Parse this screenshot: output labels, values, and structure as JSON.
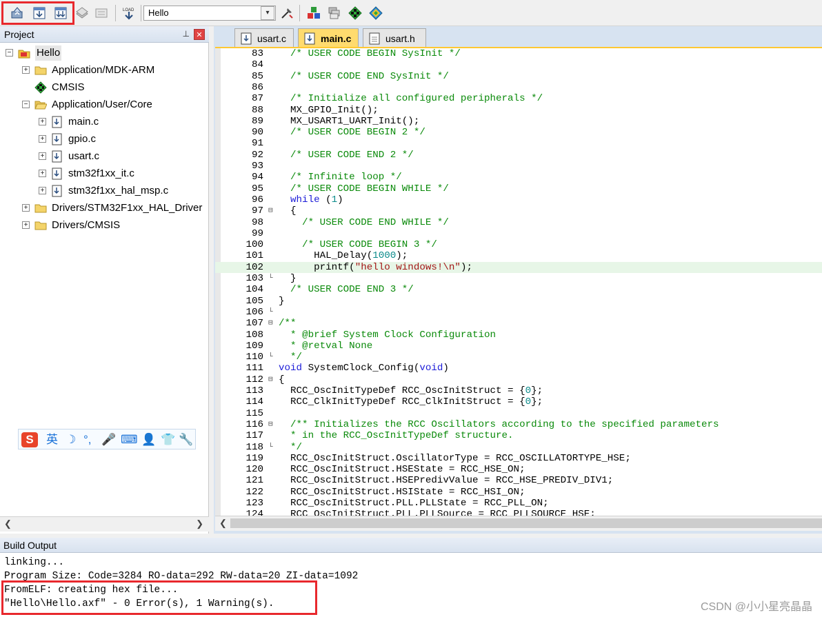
{
  "toolbar": {
    "target_name": "Hello",
    "buttons": [
      "translate-icon",
      "build-icon",
      "rebuild-icon",
      "batch-build-icon",
      "stop-build-icon",
      "download-icon",
      "target-options-icon",
      "manage-components-icon",
      "pack-installer-icon",
      "event-recorder-icon",
      "rte-icon"
    ]
  },
  "project": {
    "title": "Project",
    "tree": [
      {
        "label": "Hello",
        "level": 0,
        "type": "root",
        "expander": "-"
      },
      {
        "label": "Application/MDK-ARM",
        "level": 1,
        "type": "folder",
        "expander": "+"
      },
      {
        "label": "CMSIS",
        "level": 1,
        "type": "component",
        "expander": ""
      },
      {
        "label": "Application/User/Core",
        "level": 1,
        "type": "folder-open",
        "expander": "-"
      },
      {
        "label": "main.c",
        "level": 2,
        "type": "file",
        "expander": "+"
      },
      {
        "label": "gpio.c",
        "level": 2,
        "type": "file",
        "expander": "+"
      },
      {
        "label": "usart.c",
        "level": 2,
        "type": "file",
        "expander": "+"
      },
      {
        "label": "stm32f1xx_it.c",
        "level": 2,
        "type": "file",
        "expander": "+"
      },
      {
        "label": "stm32f1xx_hal_msp.c",
        "level": 2,
        "type": "file",
        "expander": "+"
      },
      {
        "label": "Drivers/STM32F1xx_HAL_Driver",
        "level": 1,
        "type": "folder",
        "expander": "+"
      },
      {
        "label": "Drivers/CMSIS",
        "level": 1,
        "type": "folder",
        "expander": "+"
      }
    ],
    "ime_toolbar": [
      "S",
      "英",
      "☽",
      "°,",
      "🎤",
      "⌨",
      "👤",
      "👕",
      "🔧"
    ]
  },
  "editor": {
    "tabs": [
      {
        "label": "usart.c",
        "active": false
      },
      {
        "label": "main.c",
        "active": true
      },
      {
        "label": "usart.h",
        "active": false
      }
    ],
    "lines": [
      {
        "n": "83",
        "fold": "",
        "text": "  /* USER CODE BEGIN SysInit */",
        "kind": "cm"
      },
      {
        "n": "84",
        "fold": "",
        "text": "",
        "kind": ""
      },
      {
        "n": "85",
        "fold": "",
        "text": "  /* USER CODE END SysInit */",
        "kind": "cm"
      },
      {
        "n": "86",
        "fold": "",
        "text": "",
        "kind": ""
      },
      {
        "n": "87",
        "fold": "",
        "text": "  /* Initialize all configured peripherals */",
        "kind": "cm"
      },
      {
        "n": "88",
        "fold": "",
        "text": "  MX_GPIO_Init();",
        "kind": ""
      },
      {
        "n": "89",
        "fold": "",
        "text": "  MX_USART1_UART_Init();",
        "kind": ""
      },
      {
        "n": "90",
        "fold": "",
        "text": "  /* USER CODE BEGIN 2 */",
        "kind": "cm"
      },
      {
        "n": "91",
        "fold": "",
        "text": "",
        "kind": ""
      },
      {
        "n": "92",
        "fold": "",
        "text": "  /* USER CODE END 2 */",
        "kind": "cm"
      },
      {
        "n": "93",
        "fold": "",
        "text": "",
        "kind": ""
      },
      {
        "n": "94",
        "fold": "",
        "text": "  /* Infinite loop */",
        "kind": "cm"
      },
      {
        "n": "95",
        "fold": "",
        "text": "  /* USER CODE BEGIN WHILE */",
        "kind": "cm"
      },
      {
        "n": "96",
        "fold": "",
        "text": "  while (1)",
        "kind": "while"
      },
      {
        "n": "97",
        "fold": "⊟",
        "text": "  {",
        "kind": ""
      },
      {
        "n": "98",
        "fold": "",
        "text": "    /* USER CODE END WHILE */",
        "kind": "cm"
      },
      {
        "n": "99",
        "fold": "",
        "text": "",
        "kind": ""
      },
      {
        "n": "100",
        "fold": "",
        "text": "    /* USER CODE BEGIN 3 */",
        "kind": "cm"
      },
      {
        "n": "101",
        "fold": "",
        "text": "      HAL_Delay(1000);",
        "kind": "delay"
      },
      {
        "n": "102",
        "fold": "",
        "text": "      printf(\"hello windows!\\n\");",
        "kind": "printf",
        "highlight": true
      },
      {
        "n": "103",
        "fold": "└",
        "text": "  }",
        "kind": ""
      },
      {
        "n": "104",
        "fold": "",
        "text": "  /* USER CODE END 3 */",
        "kind": "cm"
      },
      {
        "n": "105",
        "fold": "",
        "text": "}",
        "kind": ""
      },
      {
        "n": "106",
        "fold": "└",
        "text": "",
        "kind": ""
      },
      {
        "n": "107",
        "fold": "⊟",
        "text": "/**",
        "kind": "cm"
      },
      {
        "n": "108",
        "fold": "",
        "text": "  * @brief System Clock Configuration",
        "kind": "cm"
      },
      {
        "n": "109",
        "fold": "",
        "text": "  * @retval None",
        "kind": "cm"
      },
      {
        "n": "110",
        "fold": "└",
        "text": "  */",
        "kind": "cm"
      },
      {
        "n": "111",
        "fold": "",
        "text": "void SystemClock_Config(void)",
        "kind": "void"
      },
      {
        "n": "112",
        "fold": "⊟",
        "text": "{",
        "kind": ""
      },
      {
        "n": "113",
        "fold": "",
        "text": "  RCC_OscInitTypeDef RCC_OscInitStruct = {0};",
        "kind": "zero"
      },
      {
        "n": "114",
        "fold": "",
        "text": "  RCC_ClkInitTypeDef RCC_ClkInitStruct = {0};",
        "kind": "zero"
      },
      {
        "n": "115",
        "fold": "",
        "text": "",
        "kind": ""
      },
      {
        "n": "116",
        "fold": "⊟",
        "text": "  /** Initializes the RCC Oscillators according to the specified parameters",
        "kind": "cm"
      },
      {
        "n": "117",
        "fold": "",
        "text": "  * in the RCC_OscInitTypeDef structure.",
        "kind": "cm"
      },
      {
        "n": "118",
        "fold": "└",
        "text": "  */",
        "kind": "cm"
      },
      {
        "n": "119",
        "fold": "",
        "text": "  RCC_OscInitStruct.OscillatorType = RCC_OSCILLATORTYPE_HSE;",
        "kind": ""
      },
      {
        "n": "120",
        "fold": "",
        "text": "  RCC_OscInitStruct.HSEState = RCC_HSE_ON;",
        "kind": ""
      },
      {
        "n": "121",
        "fold": "",
        "text": "  RCC_OscInitStruct.HSEPredivValue = RCC_HSE_PREDIV_DIV1;",
        "kind": ""
      },
      {
        "n": "122",
        "fold": "",
        "text": "  RCC_OscInitStruct.HSIState = RCC_HSI_ON;",
        "kind": ""
      },
      {
        "n": "123",
        "fold": "",
        "text": "  RCC_OscInitStruct.PLL.PLLState = RCC_PLL_ON;",
        "kind": ""
      },
      {
        "n": "124",
        "fold": "",
        "text": "  RCC_OscInitStruct.PLL.PLLSource = RCC_PLLSOURCE_HSE;",
        "kind": ""
      }
    ]
  },
  "build": {
    "title": "Build Output",
    "lines": [
      "linking...",
      "Program Size: Code=3284 RO-data=292 RW-data=20 ZI-data=1092",
      "FromELF: creating hex file...",
      "\"Hello\\Hello.axf\" - 0 Error(s), 1 Warning(s)."
    ],
    "watermark": "CSDN @小小星亮晶晶"
  },
  "colors": {
    "comment": "#0a8a0a",
    "keyword": "#1c1cd8",
    "number": "#0a8a8a",
    "annotation_red": "#e8282d",
    "active_tab": "#ffdb6e"
  }
}
